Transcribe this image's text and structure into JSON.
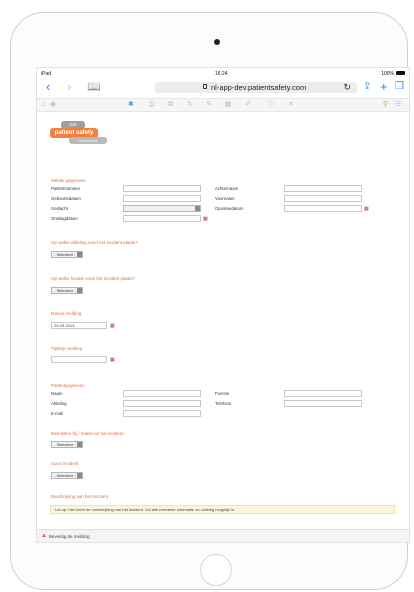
{
  "status": {
    "carrier": "iPad",
    "time": "16:24",
    "battery": "100%"
  },
  "safari": {
    "url": "nl-app-dev.patientsafety.com"
  },
  "logo": {
    "top": "SiR",
    "main": "patient safety",
    "sub": "consultant"
  },
  "sections": {
    "reporter": "Melder gegevens",
    "question1": "Op welke afdeling vond het incident plaats?",
    "question2": "Op welke locatie vond het incident plaats?",
    "date": "Datum melding",
    "time": "Tijdstip melding",
    "patient": "Patiëntgegevens",
    "question3": "Betrokken bij / relatie tot het incident:",
    "question4": "Soort incident",
    "description": "Beschrijving van het incident"
  },
  "fields": {
    "patient_number": "Patiëntnummer",
    "surname": "Achternaam",
    "date_of_birth": "Geboortedatum",
    "first_name": "Voornaam",
    "gender": "Geslacht",
    "admission_date": "Opnamedatum",
    "discharge_date": "Ontslagdatum",
    "name": "Naam",
    "function": "Functie",
    "department": "Afdeling",
    "phone": "Telefoon",
    "email": "E-mail"
  },
  "selects": {
    "select1": "- Selecteer -",
    "select2": "- Selecteer -",
    "select3": "- Selecteer -",
    "select4": "- Selecteer -"
  },
  "values": {
    "report_date": "20-03-2014"
  },
  "banner": "Let op: hier komt de omschrijving van het incident. Vul alle relevante informatie zo volledig mogelijk in.",
  "footer": "Bevestig de melding",
  "colors": {
    "accent": "#e07040",
    "safari_blue": "#2f7ef5",
    "logo_orange": "#f0803c"
  }
}
